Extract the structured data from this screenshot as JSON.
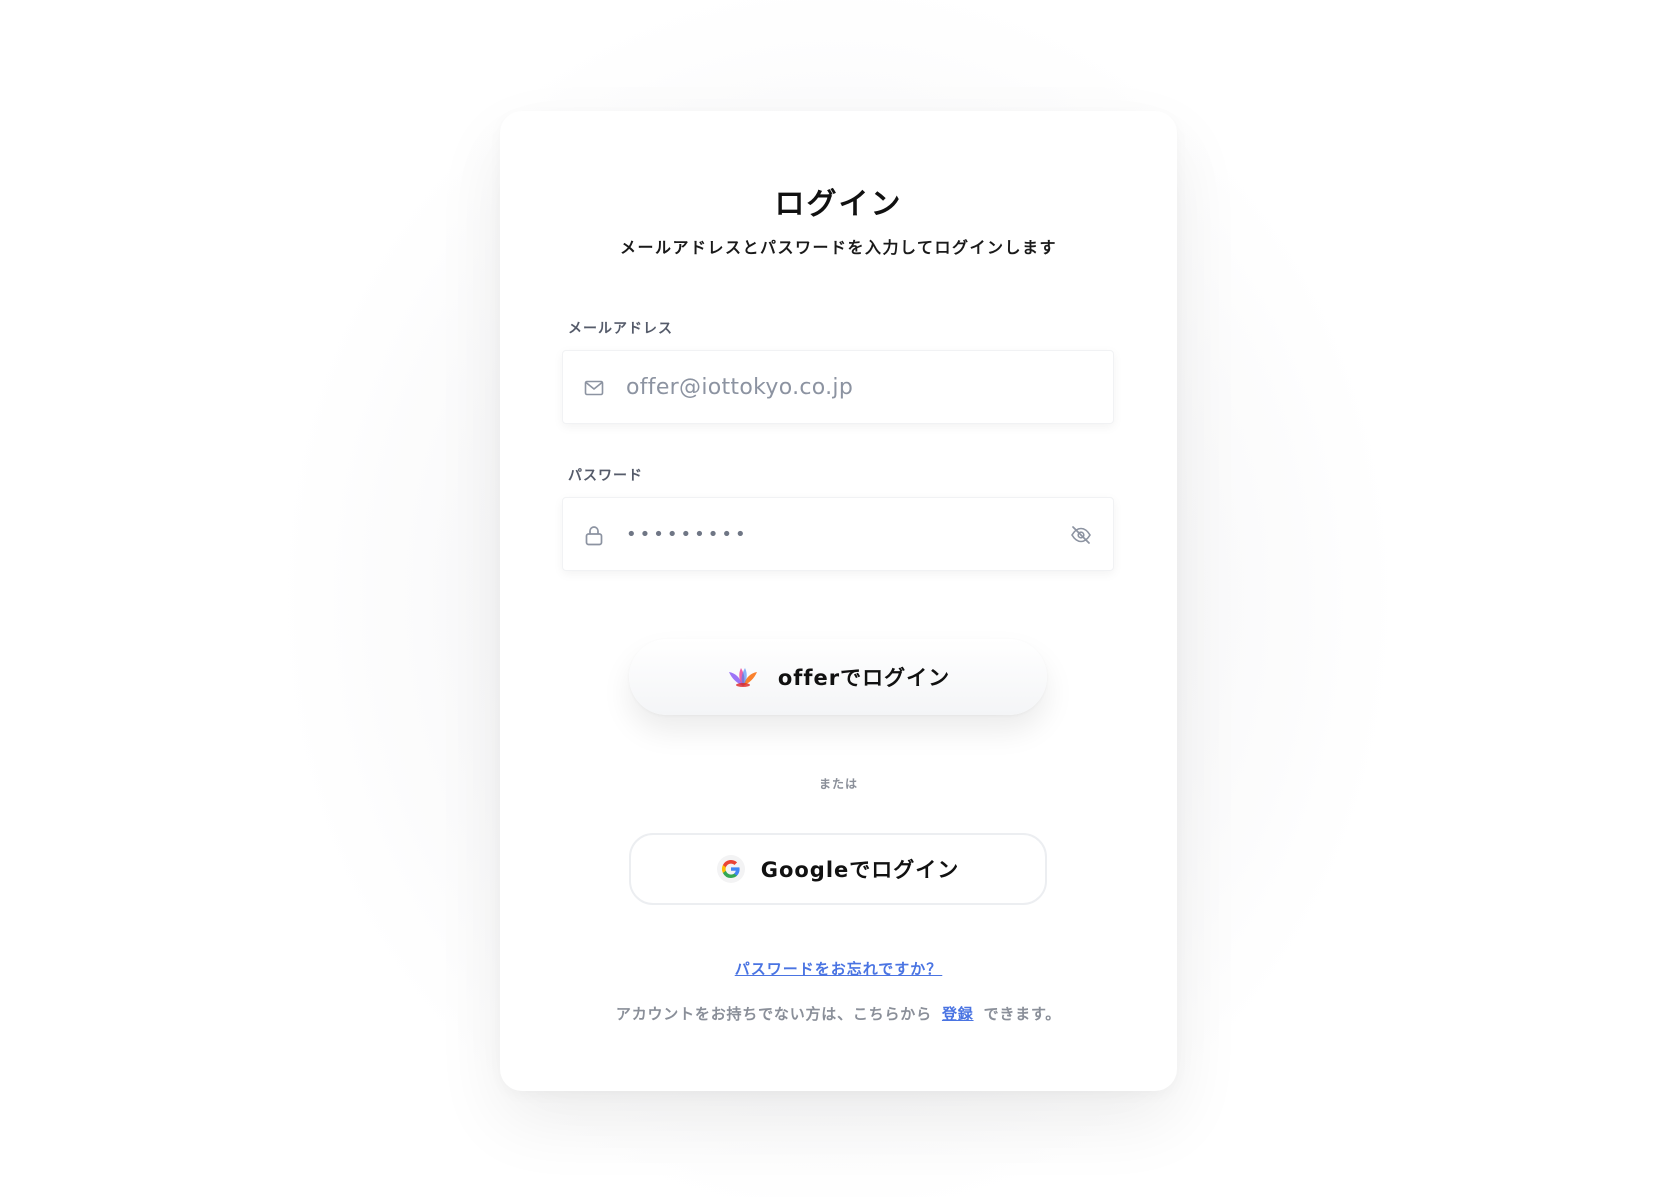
{
  "login": {
    "title": "ログイン",
    "subtitle": "メールアドレスとパスワードを入力してログインします"
  },
  "email": {
    "label": "メールアドレス",
    "value": "offer@iottokyo.co.jp",
    "icon": "mail-icon"
  },
  "password": {
    "label": "パスワード",
    "value": "•••••••••",
    "icon": "lock-icon",
    "toggle_icon": "eye-off-icon"
  },
  "offer_button": {
    "label": "offerでログイン",
    "icon": "offer-logo-icon"
  },
  "divider": {
    "text": "または"
  },
  "google_button": {
    "label": "Googleでログイン",
    "icon": "google-logo-icon"
  },
  "forgot": {
    "text": "パスワードをお忘れですか？"
  },
  "signup": {
    "prefix": "アカウントをお持ちでない方は、こちらから",
    "link": "登録",
    "suffix": "できます。"
  },
  "colors": {
    "accent_link": "#4a74e2",
    "muted_text": "#8a8f99",
    "icon_gray": "#8c93a1"
  }
}
